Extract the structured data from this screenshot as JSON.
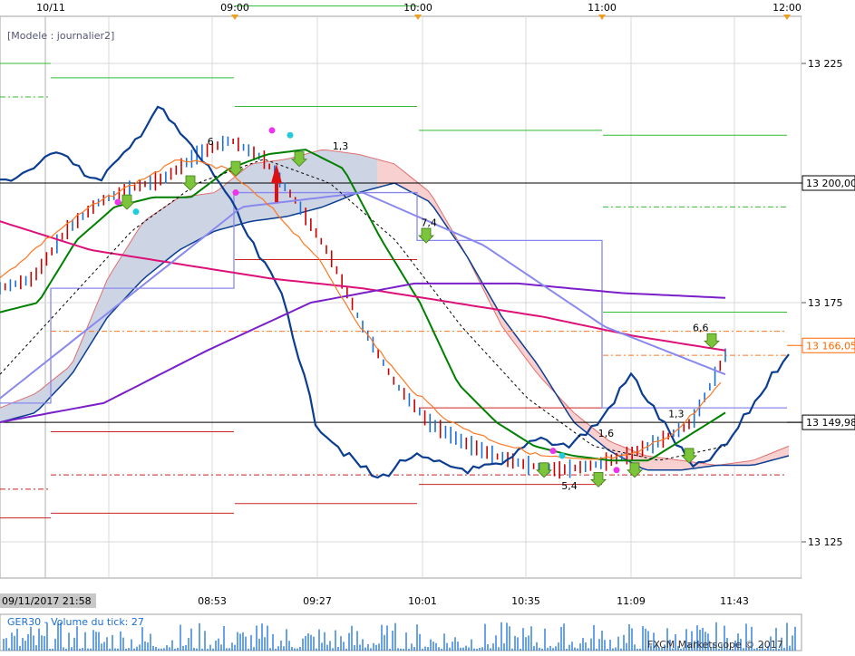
{
  "chart_data": {
    "type": "line",
    "title": "[Modele : journalier2]",
    "top_time_labels": [
      "10/11",
      "09:00",
      "10:00",
      "11:00",
      "12:00"
    ],
    "bottom_time_labels": [
      "09/11/2017 21:58",
      "08:53",
      "09:27",
      "10:01",
      "10:35",
      "11:09",
      "11:43"
    ],
    "y_axis": {
      "ticks": [
        13125,
        13175,
        13225
      ],
      "tick_labels": [
        "13 125",
        "13 175",
        "13 225"
      ],
      "ylim": [
        13113,
        13245
      ]
    },
    "price_tags": [
      {
        "label": "13 200,00",
        "value": 13200.0,
        "color": "#000000"
      },
      {
        "label": "13 166,05",
        "value": 13166.05,
        "color": "#ff6600"
      },
      {
        "label": "13 149,98",
        "value": 13149.98,
        "color": "#000000"
      }
    ],
    "annotations": [
      {
        "text": "6",
        "t": "08:51",
        "price": 13208
      },
      {
        "text": "1,3",
        "t": "09:32",
        "price": 13207
      },
      {
        "text": "7,4",
        "t": "10:01",
        "price": 13191
      },
      {
        "text": "5,4",
        "t": "10:47",
        "price": 13136
      },
      {
        "text": "1,6",
        "t": "10:59",
        "price": 13147
      },
      {
        "text": "1,3",
        "t": "11:22",
        "price": 13151
      },
      {
        "text": "6,6",
        "t": "11:30",
        "price": 13169
      }
    ],
    "series": [
      {
        "name": "",
        "color": "#0b3d91",
        "values": [
          13200,
          13203,
          13207,
          13200,
          13206,
          13216,
          13208,
          13200,
          13187,
          13176,
          13150,
          13143,
          13138,
          13143,
          13141,
          13140,
          13141,
          13147,
          13145,
          13150,
          13160,
          13150,
          13140,
          13145,
          13155,
          13165
        ]
      },
      {
        "name": "",
        "color": "#008000",
        "values": [
          13173,
          13175,
          13188,
          13195,
          13197,
          13197,
          13203,
          13206,
          13207,
          13203,
          13188,
          13175,
          13158,
          13150,
          13145,
          13143,
          13142,
          13142,
          13147,
          13152
        ]
      },
      {
        "name": "",
        "color": "#dd1177",
        "values": [
          13192,
          13186,
          13183,
          13180,
          13178,
          13175,
          13172,
          13168,
          13165
        ]
      },
      {
        "name": "",
        "color": "#7a1fc9",
        "values": [
          13150,
          13154,
          13165,
          13175,
          13179,
          13179,
          13177,
          13176
        ]
      },
      {
        "name": "",
        "color": "#8888ee",
        "values": [
          13155,
          13175,
          13195,
          13198,
          13187,
          13170,
          13160
        ]
      }
    ],
    "volume_panel": {
      "label": "GER30 - Volume du tick: 27"
    },
    "watermark": "FXCM Marketscope © 2017",
    "colors": {
      "grid": "#d9d9d9",
      "frame": "#a0a0a0",
      "price_axis_bg": "#ffffff",
      "bar_up": "#1a6fd8",
      "bar_down": "#c80000",
      "cloud_up": "#cdd5e4",
      "cloud_down": "#f9d0d0"
    }
  }
}
